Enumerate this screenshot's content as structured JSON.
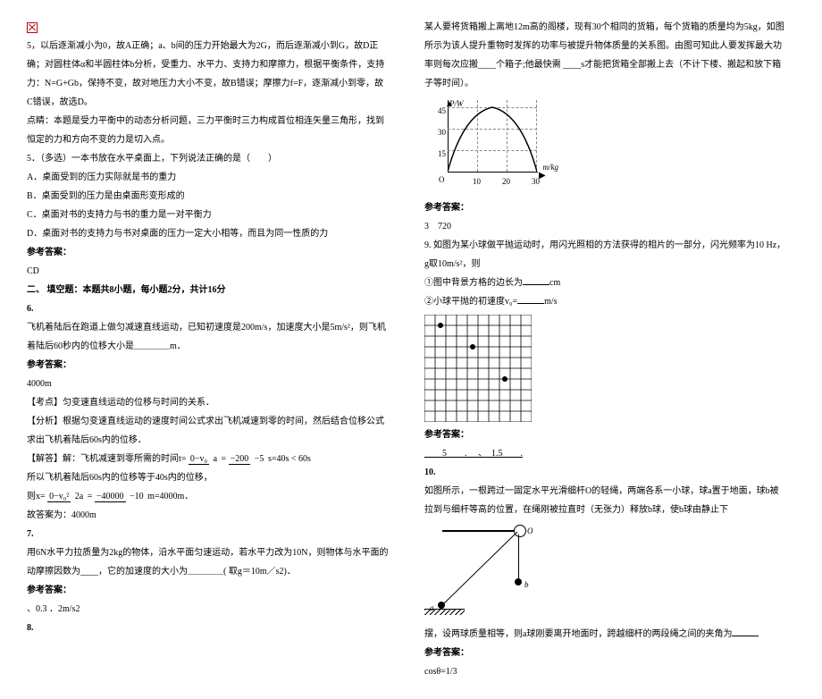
{
  "left": {
    "p1": "5，以后逐渐减小为0，故A正确；a、b间的压力开始最大为2G，而后逐渐减小到G，故D正确；对圆柱体α和半圆柱体b分析，受重力、水平力、支持力和摩擦力，根据平衡条件，支持力：N=G+Gb，保持不变，故对地压力大小不变，故B错误；摩擦力f=F，逐渐减小到零，故C错误，故选D。",
    "p2": "点睛：本题是受力平衡中的动态分析问题，三力平衡时三力构成首位相连矢量三角形，找到恒定的力和方向不变的力是切入点。",
    "q5": "5．（多选）一本书放在水平桌面上，下列说法正确的是（　　）",
    "q5a": "A．桌面受到的压力实际就是书的重力",
    "q5b": "B．桌面受到的压力是由桌面形变形成的",
    "q5c": "C．桌面对书的支持力与书的重力是一对平衡力",
    "q5d": "D．桌面对书的支持力与书对桌面的压力一定大小相等，而且为同一性质的力",
    "answer_label": "参考答案：",
    "q5_ans": "CD",
    "sec2": "二、 填空题：本题共8小题，每小题2分，共计16分",
    "q6_num": "6.",
    "q6_text": "飞机着陆后在跑道上做匀减速直线运动，已知初速度是200m/s，加速度大小是5m/s²，则飞机着陆后60秒内的位移大小是＿＿＿＿m．",
    "q6_ans": "4000m",
    "q6_point": "【考点】匀变速直线运动的位移与时间的关系．",
    "q6_analysis": "【分析】根据匀变速直线运动的速度时间公式求出飞机减速到零的时间，然后结合位移公式求出飞机着陆后60s内的位移．",
    "q6_solve1_pre": "【解答】解：飞机减速到零所需的时间t=",
    "q6_solve1_fr_top1": "0−v₀",
    "q6_solve1_fr_bot1": "a",
    "q6_solve1_eq": "=",
    "q6_solve1_fr_top2": "−200",
    "q6_solve1_fr_bot2": "−5",
    "q6_solve1_post": "s=40s < 60s",
    "q6_solve2": "所以飞机着陆后60s内的位移等于40s内的位移，",
    "q6_solve3_pre": "则x=",
    "q6_solve3_fr_top1": "0−v₀²",
    "q6_solve3_fr_bot1": "2a",
    "q6_solve3_eq": "=",
    "q6_solve3_fr_top2": "−40000",
    "q6_solve3_fr_bot2": "−10",
    "q6_solve3_post": "m=4000m．",
    "q6_solve4": "故答案为：4000m",
    "q7_num": "7.",
    "q7_text": "用6N水平力拉质量为2kg的物体，沿水平面匀速运动，若水平力改为10N，则物体与水平面的动摩擦因数为____，它的加速度的大小为＿＿＿＿( 取g＝10m／s2)．",
    "q7_ans": "、0.3 ．2m/s2",
    "q8_num": "8."
  },
  "right": {
    "q8_text": "某人要将货箱搬上离地12m高的阁楼，现有30个相同的货箱，每个货箱的质量均为5kg，如图所示为该人提升重物时发挥的功率与被提升物体质量的关系图。由图可知此人要发挥最大功率则每次应搬____个箱子;他最快需 ____s才能把货箱全部搬上去（不计下楼、搬起和放下箱子等时间）。",
    "chart": {
      "ylabel": "P/W",
      "xlabel": "m/kg",
      "y_ticks": [
        "45",
        "30",
        "15"
      ],
      "x_ticks": [
        "10",
        "20",
        "30"
      ],
      "origin": "O"
    },
    "answer_label": "参考答案：",
    "q8_ans": "3　720",
    "q9_text": "9. 如图为某小球做平抛运动时，用闪光照相的方法获得的相片的一部分，闪光频率为10 Hz，g取10m/s²，则",
    "q9_line1_a": "①图中背景方格的边长为",
    "q9_line1_b": "cm",
    "q9_line2_a": "②小球平抛的初速度",
    "q9_line2_b": "v₀=",
    "q9_line2_c": "m/s",
    "q9_ans": "　　5　　.　  、　1.5　　.",
    "q10_num": "10.",
    "q10_text": "如图所示，一根跨过一固定水平光滑细杆O的轻绳，两端各系一小球，球a置于地面，球b被拉到与细杆等高的位置，在绳刚被拉直时（无张力）释放b球，使b球由静止下",
    "q10_cont": "摆，设两球质量相等，则a球刚要离开地面时，跨越细杆的两段绳之间的夹角为",
    "pulley": {
      "o": "O",
      "a": "a",
      "b": "b"
    },
    "q10_ans": "cosθ=1/3"
  },
  "chart_data": {
    "type": "line",
    "title": "",
    "xlabel": "m/kg",
    "ylabel": "P/W",
    "x": [
      0,
      5,
      10,
      15,
      20,
      25,
      30
    ],
    "y": [
      0,
      30,
      42,
      45,
      40,
      25,
      0
    ],
    "xlim": [
      0,
      35
    ],
    "ylim": [
      0,
      50
    ],
    "x_ticks": [
      10,
      20,
      30
    ],
    "y_ticks": [
      15,
      30,
      45
    ]
  }
}
